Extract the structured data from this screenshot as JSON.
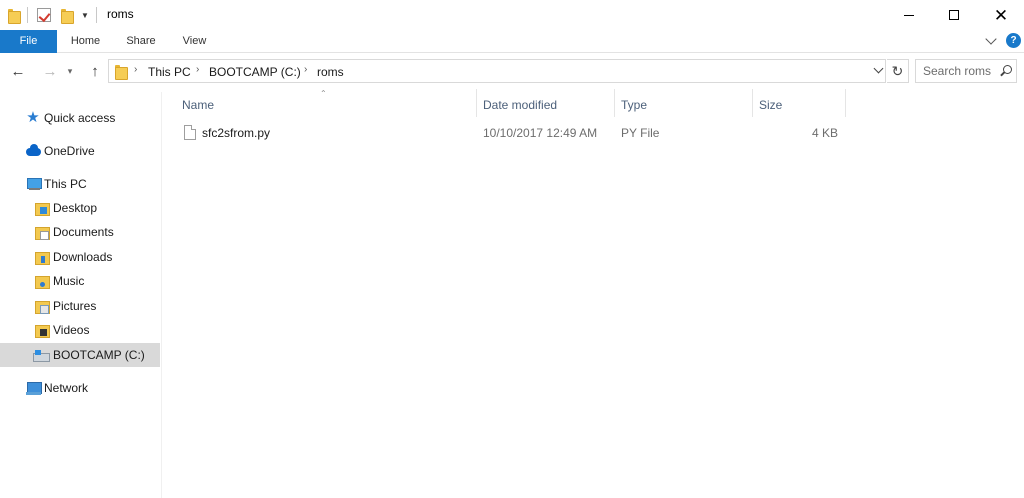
{
  "window": {
    "title": "roms",
    "minimize_glyph": "",
    "close_glyph": "✕"
  },
  "ribbon": {
    "tabs": [
      {
        "label": "File"
      },
      {
        "label": "Home"
      },
      {
        "label": "Share"
      },
      {
        "label": "View"
      }
    ],
    "help_glyph": "?",
    "accent_color": "#1979ca"
  },
  "navigation": {
    "back_glyph": "←",
    "forward_glyph": "→",
    "recent_glyph": "▾",
    "up_glyph": "↑",
    "refresh_glyph": "↻"
  },
  "address": {
    "breadcrumbs": [
      "This PC",
      "BOOTCAMP (C:)",
      "roms"
    ],
    "separator": "›"
  },
  "search": {
    "placeholder": "Search roms"
  },
  "nav_pane": {
    "items": [
      {
        "label": "Quick access",
        "icon": "star-icon"
      },
      {
        "label": "OneDrive",
        "icon": "onedrive-cloud-icon"
      },
      {
        "label": "This PC",
        "icon": "computer-icon"
      },
      {
        "label": "Desktop",
        "icon": "desktop-folder-icon"
      },
      {
        "label": "Documents",
        "icon": "documents-folder-icon"
      },
      {
        "label": "Downloads",
        "icon": "downloads-folder-icon"
      },
      {
        "label": "Music",
        "icon": "music-folder-icon"
      },
      {
        "label": "Pictures",
        "icon": "pictures-folder-icon"
      },
      {
        "label": "Videos",
        "icon": "videos-folder-icon"
      },
      {
        "label": "BOOTCAMP (C:)",
        "icon": "drive-icon",
        "selected": true
      },
      {
        "label": "Network",
        "icon": "network-icon"
      }
    ]
  },
  "file_list": {
    "sort_glyph": "⌃",
    "columns": [
      {
        "label": "Name"
      },
      {
        "label": "Date modified"
      },
      {
        "label": "Type"
      },
      {
        "label": "Size"
      }
    ],
    "rows": [
      {
        "name": "sfc2sfrom.py",
        "date_modified": "10/10/2017 12:49 AM",
        "type": "PY File",
        "size": "4 KB"
      }
    ]
  }
}
